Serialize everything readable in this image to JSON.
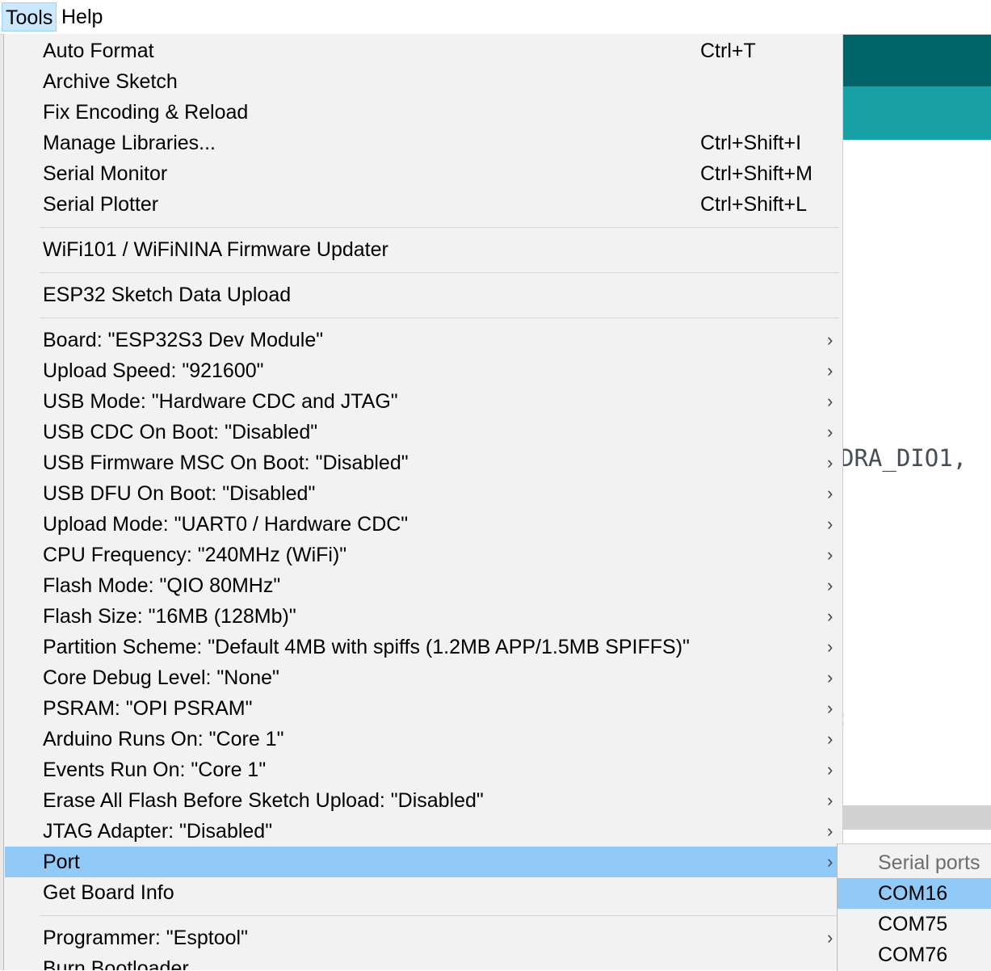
{
  "menubar": {
    "items": [
      {
        "label": "Tools"
      },
      {
        "label": "Help"
      }
    ]
  },
  "background": {
    "code_fragment": "DRA_DIO1,",
    "code_fragment2": ";"
  },
  "menu": {
    "items": [
      {
        "label": "Auto Format",
        "shortcut": "Ctrl+T"
      },
      {
        "label": "Archive Sketch",
        "shortcut": ""
      },
      {
        "label": "Fix Encoding & Reload",
        "shortcut": ""
      },
      {
        "label": "Manage Libraries...",
        "shortcut": "Ctrl+Shift+I"
      },
      {
        "label": "Serial Monitor",
        "shortcut": "Ctrl+Shift+M"
      },
      {
        "label": "Serial Plotter",
        "shortcut": "Ctrl+Shift+L"
      },
      {
        "label": "WiFi101 / WiFiNINA Firmware Updater"
      },
      {
        "label": "ESP32 Sketch Data Upload"
      },
      {
        "label": "Board: \"ESP32S3 Dev Module\""
      },
      {
        "label": "Upload Speed: \"921600\""
      },
      {
        "label": "USB Mode: \"Hardware CDC and JTAG\""
      },
      {
        "label": "USB CDC On Boot: \"Disabled\""
      },
      {
        "label": "USB Firmware MSC On Boot: \"Disabled\""
      },
      {
        "label": "USB DFU On Boot: \"Disabled\""
      },
      {
        "label": "Upload Mode: \"UART0 / Hardware CDC\""
      },
      {
        "label": "CPU Frequency: \"240MHz (WiFi)\""
      },
      {
        "label": "Flash Mode: \"QIO 80MHz\""
      },
      {
        "label": "Flash Size: \"16MB (128Mb)\""
      },
      {
        "label": "Partition Scheme: \"Default 4MB with spiffs (1.2MB APP/1.5MB SPIFFS)\""
      },
      {
        "label": "Core Debug Level: \"None\""
      },
      {
        "label": "PSRAM: \"OPI PSRAM\""
      },
      {
        "label": "Arduino Runs On: \"Core 1\""
      },
      {
        "label": "Events Run On: \"Core 1\""
      },
      {
        "label": "Erase All Flash Before Sketch Upload: \"Disabled\""
      },
      {
        "label": "JTAG Adapter: \"Disabled\""
      },
      {
        "label": "Port"
      },
      {
        "label": "Get Board Info"
      },
      {
        "label": "Programmer: \"Esptool\""
      },
      {
        "label": "Burn Bootloader"
      }
    ],
    "arrow_glyph": "›"
  },
  "submenu": {
    "header": "Serial ports",
    "items": [
      {
        "label": "COM16"
      },
      {
        "label": "COM75"
      },
      {
        "label": "COM76"
      }
    ]
  }
}
